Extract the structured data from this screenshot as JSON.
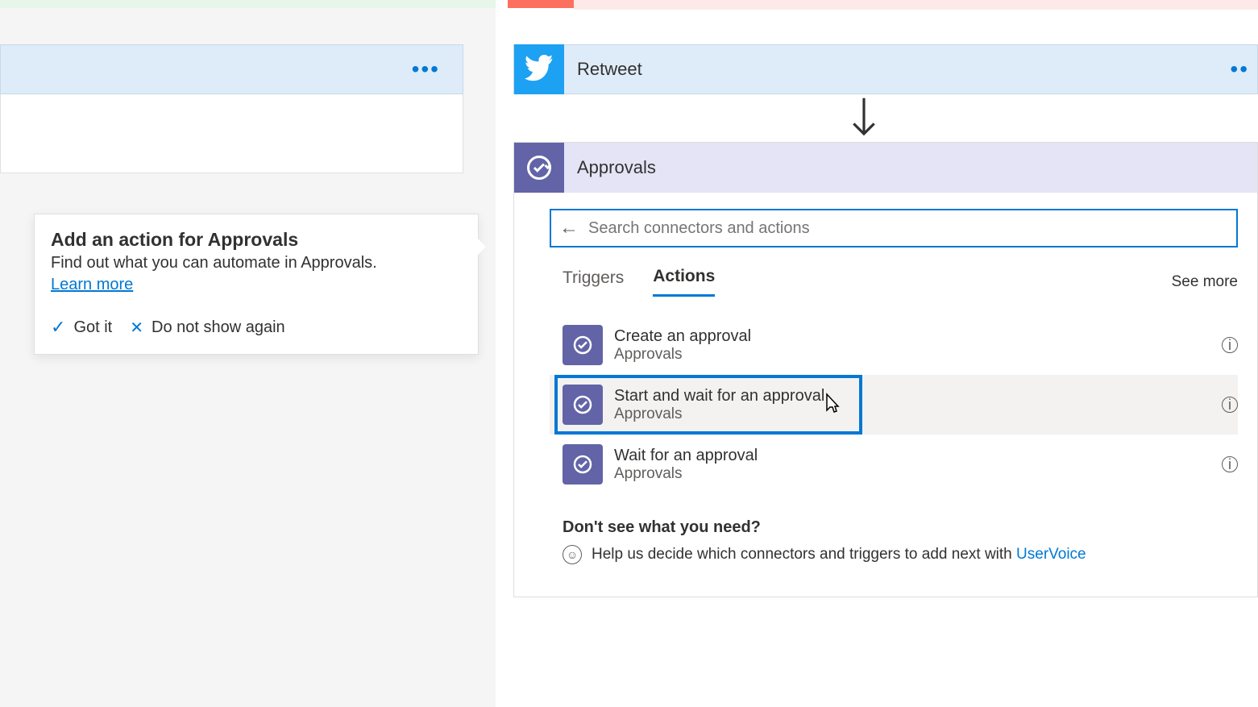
{
  "tooltip": {
    "title": "Add an action for Approvals",
    "desc": "Find out what you can automate in Approvals.",
    "learn_more": "Learn more",
    "got_it": "Got it",
    "dont_show": "Do not show again"
  },
  "retweet": {
    "title": "Retweet"
  },
  "approvals": {
    "title": "Approvals",
    "search_placeholder": "Search connectors and actions",
    "tabs": {
      "triggers": "Triggers",
      "actions": "Actions",
      "see_more": "See more"
    },
    "items": [
      {
        "name": "Create an approval",
        "sub": "Approvals"
      },
      {
        "name": "Start and wait for an approval",
        "sub": "Approvals"
      },
      {
        "name": "Wait for an approval",
        "sub": "Approvals"
      }
    ],
    "help_title": "Don't see what you need?",
    "help_text_pre": "Help us decide which connectors and triggers to add next with ",
    "help_link": "UserVoice"
  }
}
